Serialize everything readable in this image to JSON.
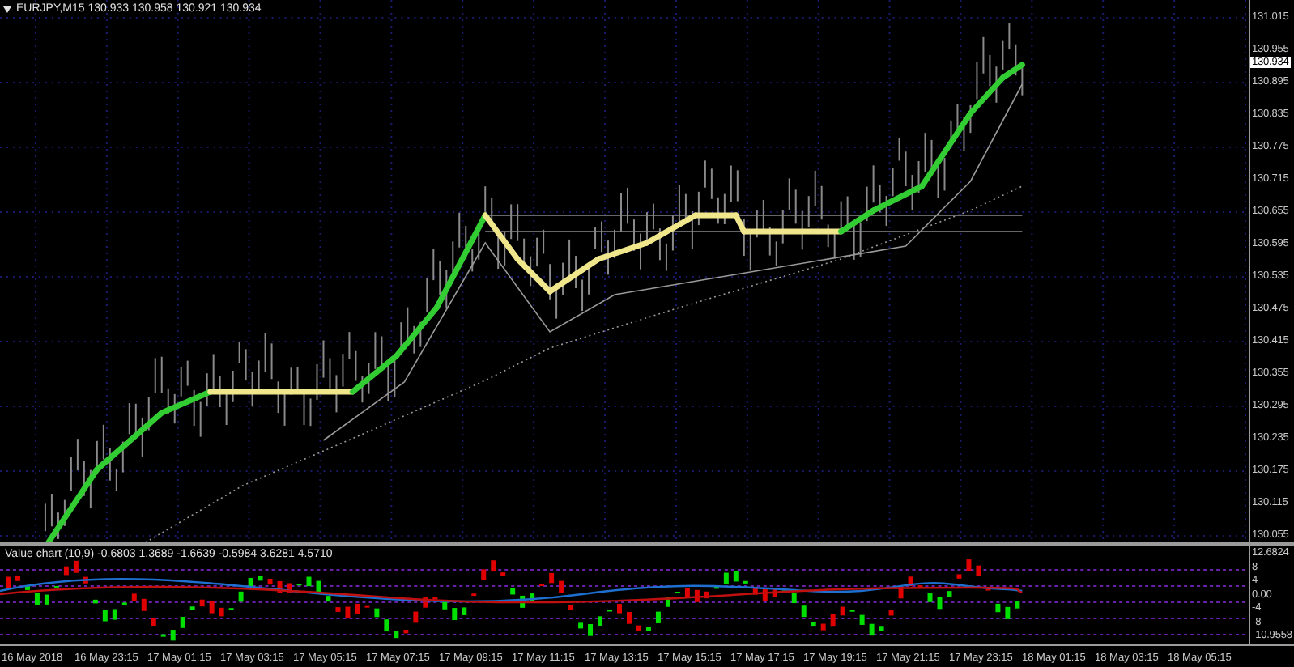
{
  "chart": {
    "header": "EURJPY,M15  130.933 130.958 130.921 130.934",
    "price_axis": [
      "131.015",
      "130.955",
      "130.895",
      "130.835",
      "130.775",
      "130.715",
      "130.655",
      "130.595",
      "130.535",
      "130.475",
      "130.415",
      "130.355",
      "130.295",
      "130.235",
      "130.175",
      "130.115",
      "130.055"
    ],
    "current_price": "130.934"
  },
  "indicator": {
    "title": "Value chart (10,9) -0.6803 1.3689 -1.6639 -0.5984 3.6281 4.5710",
    "axis_labels": [
      "12.6824",
      "8",
      "4",
      "0.00",
      "-4",
      "-8",
      "-10.9558"
    ]
  },
  "time_axis": [
    "16 May 2018",
    "16 May 23:15",
    "17 May 01:15",
    "17 May 03:15",
    "17 May 05:15",
    "17 May 07:15",
    "17 May 09:15",
    "17 May 11:15",
    "17 May 13:15",
    "17 May 15:15",
    "17 May 17:15",
    "17 May 19:15",
    "17 May 21:15",
    "17 May 23:15",
    "18 May 01:15",
    "18 May 03:15",
    "18 May 05:15"
  ]
}
